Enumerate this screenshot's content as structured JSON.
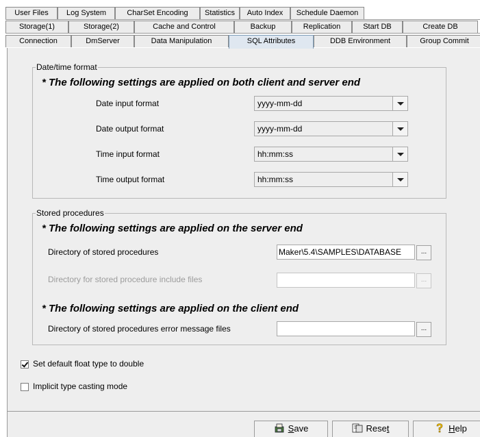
{
  "tabs_row1": [
    "User Files",
    "Log System",
    "CharSet Encoding",
    "Statistics",
    "Auto Index",
    "Schedule Daemon"
  ],
  "tabs_row2": [
    "Storage(1)",
    "Storage(2)",
    "Cache and Control",
    "Backup",
    "Replication",
    "Start DB",
    "Create DB"
  ],
  "tabs_row3": [
    "Connection",
    "DmServer",
    "Data Manipulation",
    "SQL Attributes",
    "DDB Environment",
    "Group Commit"
  ],
  "active_tab": "SQL Attributes",
  "datetime": {
    "legend": "Date/time format",
    "note": "* The following settings are applied on both client and server end",
    "rows": [
      {
        "label": "Date input format",
        "value": "yyyy-mm-dd"
      },
      {
        "label": "Date output format",
        "value": "yyyy-mm-dd"
      },
      {
        "label": "Time input format",
        "value": "hh:mm:ss"
      },
      {
        "label": "Time output format",
        "value": "hh:mm:ss"
      }
    ]
  },
  "stored": {
    "legend": "Stored procedures",
    "note_server": "* The following settings are applied on the server end",
    "dir_label": "Directory of stored procedures",
    "dir_value": "Maker\\5.4\\SAMPLES\\DATABASE",
    "include_label": "Directory for stored procedure include files",
    "include_value": "",
    "note_client": "* The following settings are applied on the client end",
    "error_label": "Directory of stored procedures error message files",
    "error_value": "",
    "browse_label": "..."
  },
  "options": {
    "float_double": {
      "label": "Set default float type to double",
      "checked": true
    },
    "implicit_cast": {
      "label": "Implicit type casting mode",
      "checked": false
    }
  },
  "buttons": {
    "save": {
      "pre": "",
      "accel": "S",
      "post": "ave"
    },
    "reset": {
      "pre": "Rese",
      "accel": "t",
      "post": ""
    },
    "help": {
      "pre": "",
      "accel": "H",
      "post": "elp"
    }
  },
  "colors": {
    "panel": "#eeeeee",
    "active_tab": "#dfe7f0",
    "help_icon": "#f2c200"
  }
}
